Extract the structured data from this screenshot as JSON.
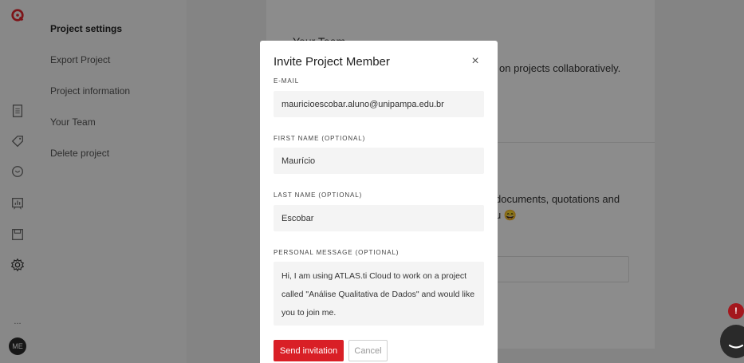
{
  "rail": {
    "logo_color": "#e3262d",
    "icons": [
      "logo-icon",
      "documents-icon",
      "codes-icon",
      "memos-icon",
      "analysis-icon",
      "notes-icon",
      "settings-icon",
      "more-icon"
    ],
    "more_label": "...",
    "avatar_initials": "ME"
  },
  "settings_nav": {
    "heading": "Project settings",
    "items": [
      {
        "label": "Export Project"
      },
      {
        "label": "Project information"
      },
      {
        "label": "Your Team"
      },
      {
        "label": "Delete project"
      }
    ]
  },
  "background": {
    "team_title": "Your Team",
    "team_desc_fragment": "on projects collaboratively.",
    "delete_desc_fragment_1": "documents, quotations and",
    "delete_desc_fragment_2": "u 😄"
  },
  "modal": {
    "title": "Invite Project Member",
    "close_glyph": "×",
    "email_label": "E-MAIL",
    "email_value": "mauricioescobar.aluno@unipampa.edu.br",
    "first_name_label": "FIRST NAME (OPTIONAL)",
    "first_name_value": "Maurício",
    "last_name_label": "LAST NAME (OPTIONAL)",
    "last_name_value": "Escobar",
    "message_label": "PERSONAL MESSAGE (OPTIONAL)",
    "message_value": "Hi, I am using ATLAS.ti Cloud to work on a project called \"Análise Qualitativa de Dados\" and would like you to join me.",
    "send_label": "Send invitation",
    "cancel_label": "Cancel"
  },
  "widgets": {
    "notification_badge": "!"
  },
  "colors": {
    "accent": "#d91f26",
    "overlay": "rgba(0,0,0,0.45)"
  }
}
